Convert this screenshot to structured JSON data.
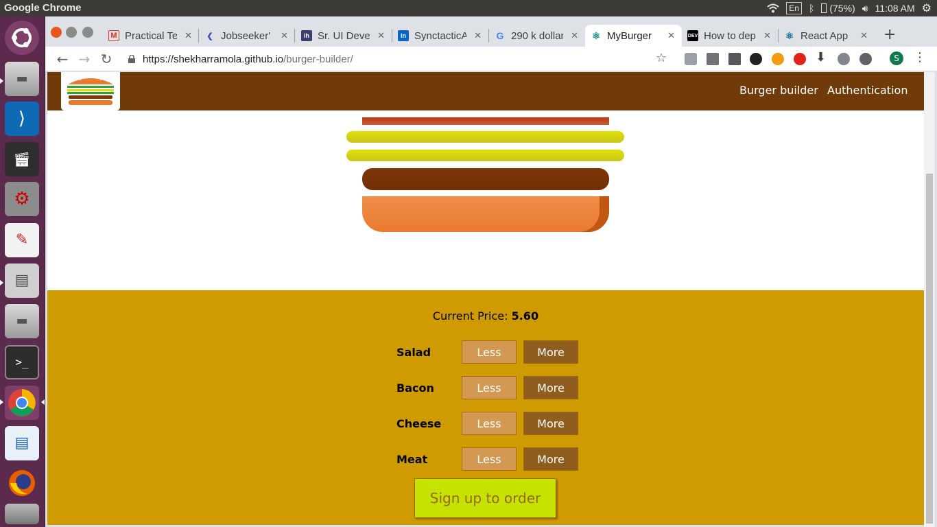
{
  "system": {
    "app_title": "Google Chrome",
    "keyboard": "En",
    "battery": "(75%)",
    "clock": "11:08 AM"
  },
  "launcher": {
    "items": [
      "ubuntu-dash-icon",
      "disk-icon",
      "vscode-icon",
      "video-editor-icon",
      "settings-icon",
      "text-editor-icon",
      "file-cabinet-icon",
      "disk-icon",
      "terminal-icon",
      "chrome-icon",
      "writer-icon",
      "firefox-icon",
      "trash-icon"
    ]
  },
  "browser": {
    "tabs": [
      {
        "label": "Practical Te",
        "favicon": "gmail-icon"
      },
      {
        "label": "Jobseeker'",
        "favicon": "kendo-icon"
      },
      {
        "label": "Sr. UI Devel",
        "favicon": "ih-icon"
      },
      {
        "label": "SynctacticA",
        "favicon": "linkedin-icon"
      },
      {
        "label": "290 k dollar",
        "favicon": "google-icon"
      },
      {
        "label": "MyBurger",
        "favicon": "react-icon"
      },
      {
        "label": "How to dep",
        "favicon": "dev-icon"
      },
      {
        "label": "React App",
        "favicon": "react-icon"
      }
    ],
    "active_tab": "MyBurger",
    "url_host": "https://shekharramola.github.io",
    "url_path": "/burger-builder/",
    "profile_initial": "S"
  },
  "site": {
    "nav": {
      "burger_builder": "Burger builder",
      "authentication": "Authentication"
    },
    "burger_layers": [
      "bacon",
      "salad",
      "salad",
      "meat",
      "bread-bottom"
    ],
    "price_label": "Current Price: ",
    "price_value": "5.60",
    "controls": [
      {
        "label": "Salad",
        "less": "Less",
        "more": "More"
      },
      {
        "label": "Bacon",
        "less": "Less",
        "more": "More"
      },
      {
        "label": "Cheese",
        "less": "Less",
        "more": "More"
      },
      {
        "label": "Meat",
        "less": "Less",
        "more": "More"
      }
    ],
    "order_button": "Sign up to order"
  },
  "colors": {
    "header": "#703b09",
    "controls_bg": "#cf9b00",
    "order_bg": "#c6e200"
  }
}
